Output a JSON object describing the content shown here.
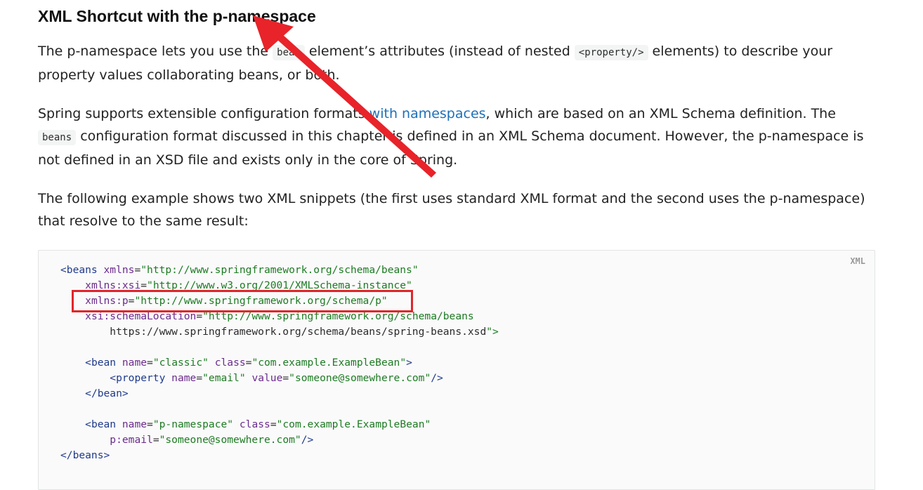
{
  "heading": "XML Shortcut with the p-namespace",
  "para1": {
    "text1": "The p-namespace lets you use the ",
    "code1": "bean",
    "text2": " element’s attributes (instead of nested ",
    "code2": "<property/>",
    "text3": " elements) to describe your property values collaborating beans, or both."
  },
  "para2": {
    "text1": "Spring supports extensible configuration formats ",
    "link": "with namespaces",
    "text2": ", which are based on an XML Schema definition. The ",
    "code1": "beans",
    "text3": " configuration format discussed in this chapter is defined in an XML Schema document. However, the p-namespace is not defined in an XSD file and exists only in the core of Spring."
  },
  "para3": {
    "text": "The following example shows two XML snippets (the first uses standard XML format and the second uses the p-namespace) that resolve to the same result:"
  },
  "codeblock": {
    "language": "XML",
    "lines": [
      "<beans xmlns=\"http://www.springframework.org/schema/beans\"",
      "    xmlns:xsi=\"http://www.w3.org/2001/XMLSchema-instance\"",
      "    xmlns:p=\"http://www.springframework.org/schema/p\"",
      "    xsi:schemaLocation=\"http://www.springframework.org/schema/beans",
      "        https://www.springframework.org/schema/beans/spring-beans.xsd\">",
      "",
      "    <bean name=\"classic\" class=\"com.example.ExampleBean\">",
      "        <property name=\"email\" value=\"someone@somewhere.com\"/>",
      "    </bean>",
      "",
      "    <bean name=\"p-namespace\" class=\"com.example.ExampleBean\"",
      "        p:email=\"someone@somewhere.com\"/>",
      "</beans>"
    ]
  },
  "annotation": {
    "box_color": "#e0262b",
    "arrow_color": "#e8232a"
  }
}
